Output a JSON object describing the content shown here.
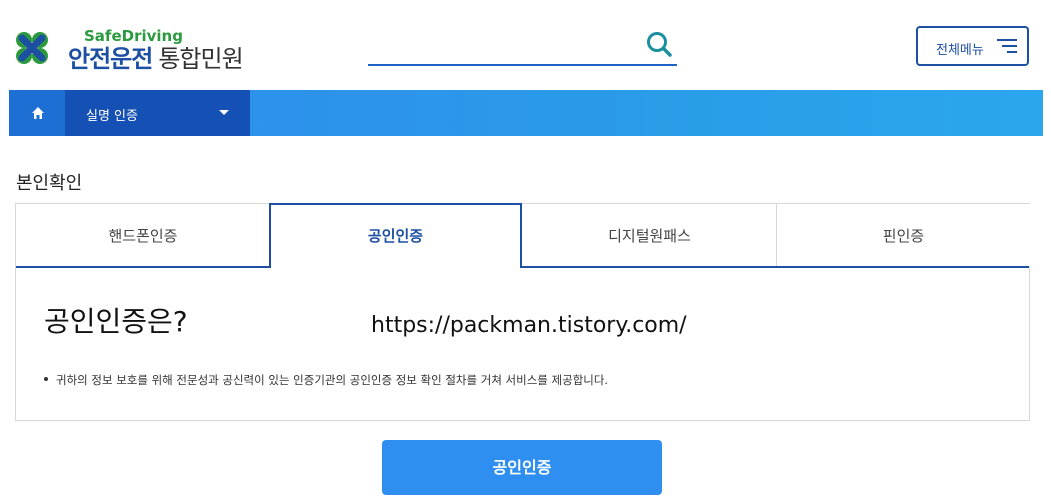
{
  "header": {
    "logo_sub": "SafeDriving",
    "logo_main_a": "안전운전",
    "logo_main_b": "통합민원",
    "search": {
      "value": "",
      "placeholder": ""
    },
    "menu_label": "전체메뉴"
  },
  "nav": {
    "home_icon": "home-icon",
    "current": "실명 인증"
  },
  "page": {
    "section_title": "본인확인",
    "tabs": [
      {
        "label": "핸드폰인증",
        "active": false
      },
      {
        "label": "공인인증",
        "active": true
      },
      {
        "label": "디지털원패스",
        "active": false
      },
      {
        "label": "핀인증",
        "active": false
      }
    ],
    "content_title": "공인인증은?",
    "watermark": "https://packman.tistory.com/",
    "bullet": "귀하의 정보 보호를 위해 전문성과 공신력이 있는 인증기관의 공인인증 정보 확인 절차를 거쳐 서비스를 제공합니다.",
    "cta_label": "공인인증"
  },
  "colors": {
    "brand_blue": "#1d4fa3",
    "brand_green": "#2b9a3e",
    "nav_blue": "#2e8bed",
    "nav_dark": "#1550b4",
    "cta_blue": "#2e8ff0"
  }
}
